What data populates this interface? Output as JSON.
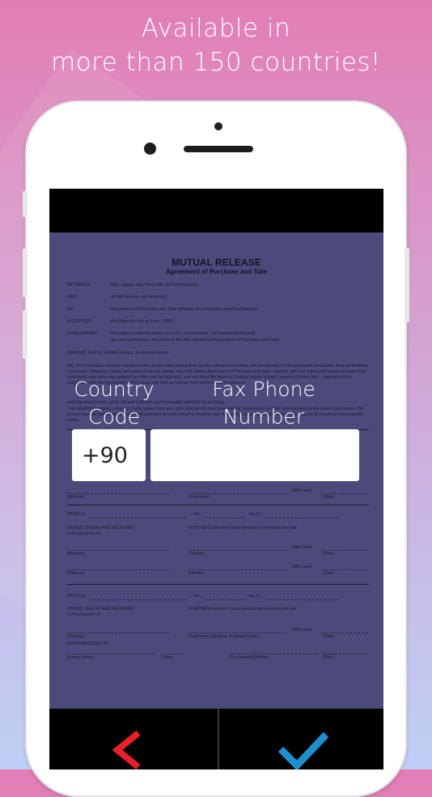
{
  "headline": {
    "line1": "Available in",
    "line2": "more than 150 countries!"
  },
  "document": {
    "title": "MUTUAL RELEASE",
    "subtitle": "Agreement of Purchase and Sale",
    "rows": [
      {
        "key": "BETWEEN:",
        "value": "Rick Jagger and Terry Hall, as Purchaser(s)"
      },
      {
        "key": "AND:",
        "value": "ACME Homes, as Vendor(s)"
      },
      {
        "key": "RE:",
        "value": "Agreement of Purchase and Sale between the Vendor(s) and Purchaser(s)"
      },
      {
        "key": "ACCEPTED:",
        "value": "the Fifteenth day of June , 2001"
      },
      {
        "key": "CONCERNING:",
        "value": "the subject property known as: Lot 1, Concession 7 (2 Sunset Boulevard)"
      }
    ],
    "concerning_cont": "as more particularly described in the first mentioned Agreement of Purchase and Sale.",
    "deposit": "DEPOSIT held by: ACME Homes, as deposit holder",
    "para1": "WE, the Purchasers and the Vendors in the above noted transaction, hereby release each other and the Agent(s) in the proposed transaction, from all liabilities, covenants, obligation, claims and sums of money arising out of the above Agreement of Purchase and Sale, together with any rights and causes of action that each party may have had against the other and the Agent(s), and we direct the Agent or Deposit Holder to pay Canadian Dollars and ... deposit held in connection with the Agreement of Purchase and Sale as follows: Full refund to the Purchasers",
    "para2": "and this shall be their good, full and sufficient and irrevocable authority for so doing.",
    "para3": "THE AGENT(S) hereby release(s) both parties from any claim that he/she may have had for commission or other remuneration in the above transaction. This release may be hereinbefore specifically provided for and it shall be binding upon the heirs, executors, administrators, successors of all parties executing the same.",
    "dated": "DATED at",
    "this": "this",
    "day_of": "day of",
    "signed": "SIGNED, SEALED AND DELIVERED",
    "presence": "In the presence of:",
    "witness_text": "IN WITNESS whereof I have hereunto set my hand and seal:",
    "witness": "(Witness)",
    "purchaser": "(Purchaser)",
    "vendor": "(Vendor)",
    "date": "(Date)",
    "affix": "(Affix Seal)",
    "authorized": "(Authorized Signature of deposit holder)",
    "acknowledged": "ACKNOWLEDGED BY:",
    "listing_broker": "(Listing Broker)",
    "cooperating_broker": "(Co-operating Broker)"
  },
  "form": {
    "country_code_label": "Country Code",
    "country_code_value": "+90",
    "fax_label": "Fax Phone Number",
    "fax_value": "",
    "fax_placeholder": ""
  },
  "actions": {
    "back_icon": "chevron-left-icon",
    "confirm_icon": "checkmark-icon",
    "back_color": "#e8202a",
    "confirm_color": "#1f8fd0"
  }
}
